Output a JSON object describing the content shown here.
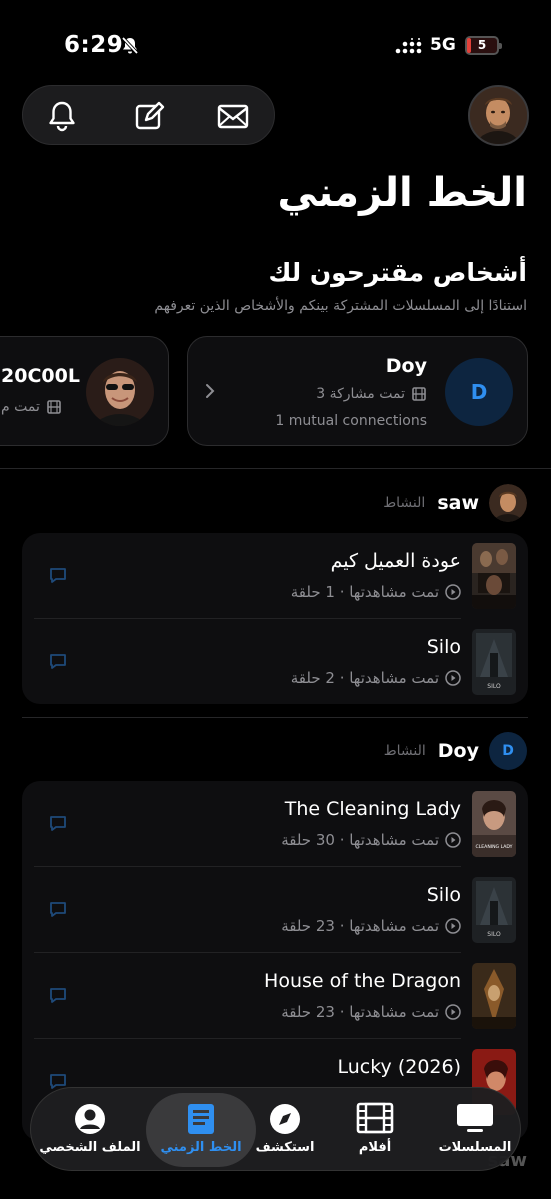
{
  "status": {
    "time": "6:29",
    "network": "5G",
    "battery": "5",
    "battery_level": 0.12
  },
  "topbar": {
    "icons": [
      "bell-icon",
      "compose-icon",
      "mail-icon"
    ]
  },
  "header": {
    "title": "الخط الزمني"
  },
  "suggestions": {
    "title": "أشخاص مقترحون لك",
    "subtitle": "استنادًا إلى المسلسلات المشتركة بينكم والأشخاص الذين تعرفهم",
    "cards": [
      {
        "initial": "D",
        "name": "Doy",
        "shared": "تمت مشاركة 3",
        "mutual": "1 mutual connections"
      },
      {
        "name": "20C00L",
        "shared": "تمت م"
      }
    ]
  },
  "activity_label": "النشاط",
  "feeds": [
    {
      "user": "saw",
      "items": [
        {
          "title": "عودة العميل كيم",
          "meta": "تمت مشاهدتها · 1 حلقة"
        },
        {
          "title": "Silo",
          "meta": "تمت مشاهدتها · 2 حلقة"
        }
      ]
    },
    {
      "user": "Doy",
      "initial": "D",
      "items": [
        {
          "title": "The Cleaning Lady",
          "meta": "تمت مشاهدتها · 30 حلقة"
        },
        {
          "title": "Silo",
          "meta": "تمت مشاهدتها · 23 حلقة"
        },
        {
          "title": "House of the Dragon",
          "meta": "تمت مشاهدتها · 23 حلقة"
        },
        {
          "title": "Lucky (2026)",
          "meta": ""
        }
      ]
    }
  ],
  "posters": {
    "silo": "SILO",
    "cleaning": "CLEANING LADY"
  },
  "tabs": [
    {
      "label": "المسلسلات"
    },
    {
      "label": "أفلام"
    },
    {
      "label": "استكشف"
    },
    {
      "label": "الخط الزمني",
      "active": true
    },
    {
      "label": "الملف الشخصي"
    }
  ],
  "ghost_name": "saw",
  "colors": {
    "accent": "#2f8ff0",
    "background": "#000000",
    "card": "#0e0e10"
  }
}
